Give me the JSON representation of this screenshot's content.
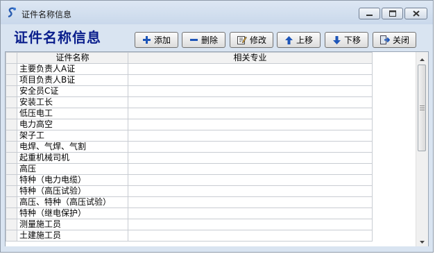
{
  "window": {
    "title": "证件名称信息",
    "controls": [
      "minimize-icon",
      "maximize-icon",
      "close-icon"
    ]
  },
  "header": {
    "title": "证件名称信息"
  },
  "toolbar": {
    "buttons": [
      {
        "label": "添加",
        "icon": "plus-icon"
      },
      {
        "label": "删除",
        "icon": "minus-icon"
      },
      {
        "label": "修改",
        "icon": "edit-icon"
      },
      {
        "label": "上移",
        "icon": "arrow-up-icon"
      },
      {
        "label": "下移",
        "icon": "arrow-down-icon"
      },
      {
        "label": "关闭",
        "icon": "exit-icon"
      }
    ]
  },
  "table": {
    "columns": [
      "证件名称",
      "相关专业"
    ],
    "rows": [
      [
        "主要负责人A证",
        ""
      ],
      [
        "项目负责人B证",
        ""
      ],
      [
        "安全员C证",
        ""
      ],
      [
        "安装工长",
        ""
      ],
      [
        "低压电工",
        ""
      ],
      [
        "电力高空",
        ""
      ],
      [
        "架子工",
        ""
      ],
      [
        "电焊、气焊、气割",
        ""
      ],
      [
        "起重机械司机",
        ""
      ],
      [
        "高压",
        ""
      ],
      [
        "特种（电力电缆）",
        ""
      ],
      [
        "特种（高压试验）",
        ""
      ],
      [
        "高压、特种（高压试验）",
        ""
      ],
      [
        "特种（继电保护）",
        ""
      ],
      [
        "测量施工员",
        ""
      ],
      [
        "土建施工员",
        ""
      ]
    ]
  },
  "colors": {
    "window_bg": "#d9e4f1",
    "title_text": "#0a1e8c",
    "grid_line": "#c8ccd2"
  }
}
